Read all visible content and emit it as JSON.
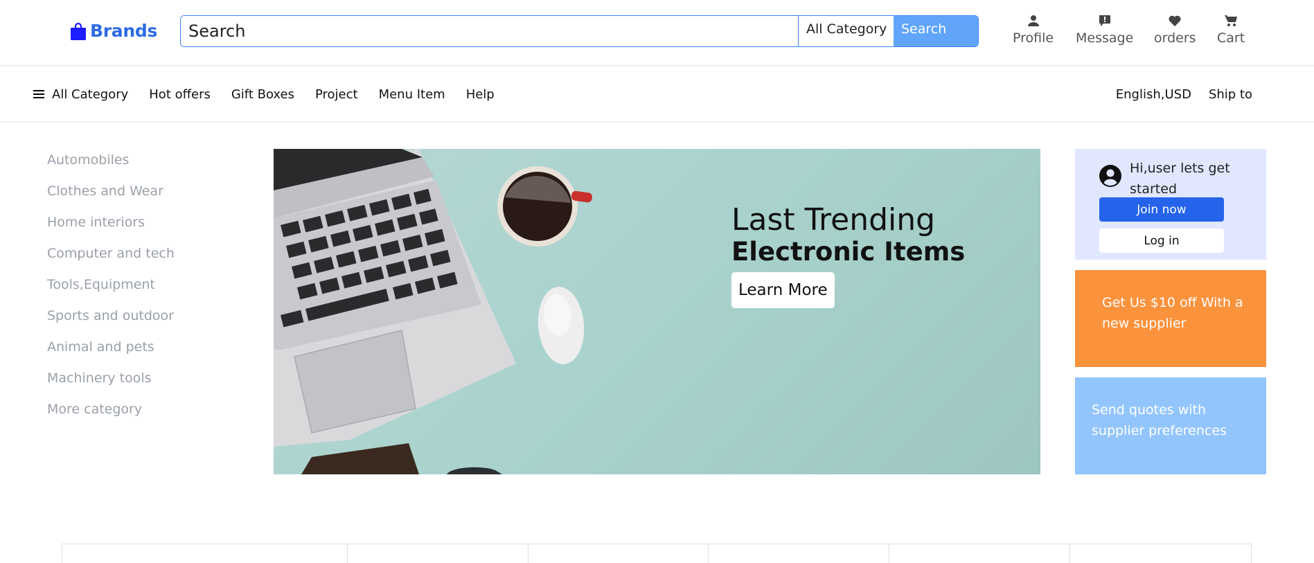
{
  "header": {
    "logo_text": "Brands",
    "search": {
      "placeholder": "Search",
      "category": "All Category",
      "button_label": "Search"
    },
    "actions": [
      {
        "label": "Profile",
        "icon": "user-icon"
      },
      {
        "label": "Message",
        "icon": "message-icon"
      },
      {
        "label": "orders",
        "icon": "heart-icon"
      },
      {
        "label": "Cart",
        "icon": "cart-icon"
      }
    ]
  },
  "nav": {
    "all_category": "All Category",
    "items": [
      "Hot offers",
      "Gift Boxes",
      "Project",
      "Menu Item",
      "Help"
    ],
    "language": "English,USD",
    "ship_to": "Ship to"
  },
  "categories": [
    "Automobiles",
    "Clothes and Wear",
    "Home interiors",
    "Computer and tech",
    "Tools,Equipment",
    "Sports and outdoor",
    "Animal and pets",
    "Machinery tools",
    "More category"
  ],
  "banner": {
    "line1": "Last Trending",
    "line2": "Electronic Items",
    "button_label": "Learn More"
  },
  "user_card": {
    "greeting": "Hi,user lets get started",
    "join_label": "Join now",
    "login_label": "Log in"
  },
  "promos": {
    "orange_text": "Get Us $10 off With a new supplier",
    "blue_text": "Send quotes with supplier preferences"
  },
  "colors": {
    "brand": "#2d6be4",
    "search_button": "#60a5fa",
    "join_button": "#2563eb",
    "user_card_bg": "#e0e7ff",
    "promo_orange": "#fb923c",
    "promo_blue": "#93c5fd"
  }
}
